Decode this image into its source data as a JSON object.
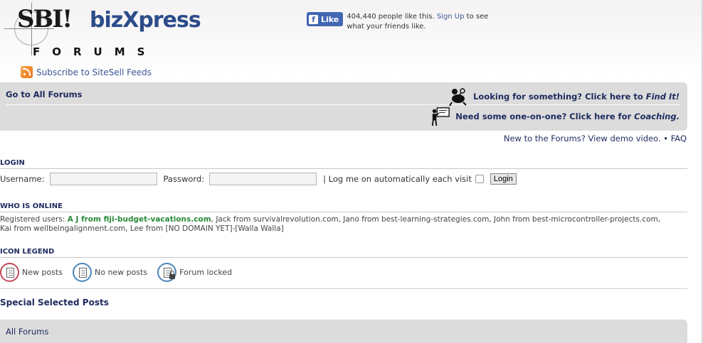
{
  "header": {
    "logo_sbi": "SBI!",
    "logo_biz": "bizXpress",
    "logo_forums": "FORUMS",
    "subscribe_label": "Subscribe to SiteSell Feeds"
  },
  "facebook": {
    "like_label": "Like",
    "count_text": "404,440 people like this.",
    "signup_label": "Sign Up",
    "tail_text": "to see what your friends like."
  },
  "nav": {
    "goto_label": "Go to All Forums",
    "find_text": "Looking for something? Click here to",
    "find_link": "Find It!",
    "coach_text": "Need some one-on-one? Click here for",
    "coach_link": "Coaching."
  },
  "demo": {
    "demo_text": "New to the Forums? View demo video.",
    "bullet": "•",
    "faq_label": "FAQ"
  },
  "login": {
    "heading": "LOGIN",
    "username_label": "Username:",
    "password_label": "Password:",
    "remember_label": "| Log me on automatically each visit",
    "button_label": "Login"
  },
  "online": {
    "heading": "WHO IS ONLINE",
    "prefix": "Registered users:",
    "first_user": "A J from fiji-budget-vacations.com",
    "rest": ", Jack from survivalrevolution.com, Jano from best-learning-strategies.com, John from best-microcontroller-projects.com, Kai from wellbeingalignment.com, Lee from [NO DOMAIN YET]-[Walla Walla]"
  },
  "legend": {
    "heading": "ICON LEGEND",
    "items": [
      {
        "label": "New posts",
        "icon": "new-posts-icon"
      },
      {
        "label": "No new posts",
        "icon": "no-new-posts-icon"
      },
      {
        "label": "Forum locked",
        "icon": "forum-locked-icon"
      }
    ]
  },
  "special": {
    "heading": "Special Selected Posts"
  },
  "all_forums": {
    "label": "All Forums"
  },
  "colors": {
    "navy": "#1d2a5e",
    "facebook_blue": "#4267b2",
    "online_green": "#2a8a3a",
    "nav_grey": "#dcdcdc"
  }
}
